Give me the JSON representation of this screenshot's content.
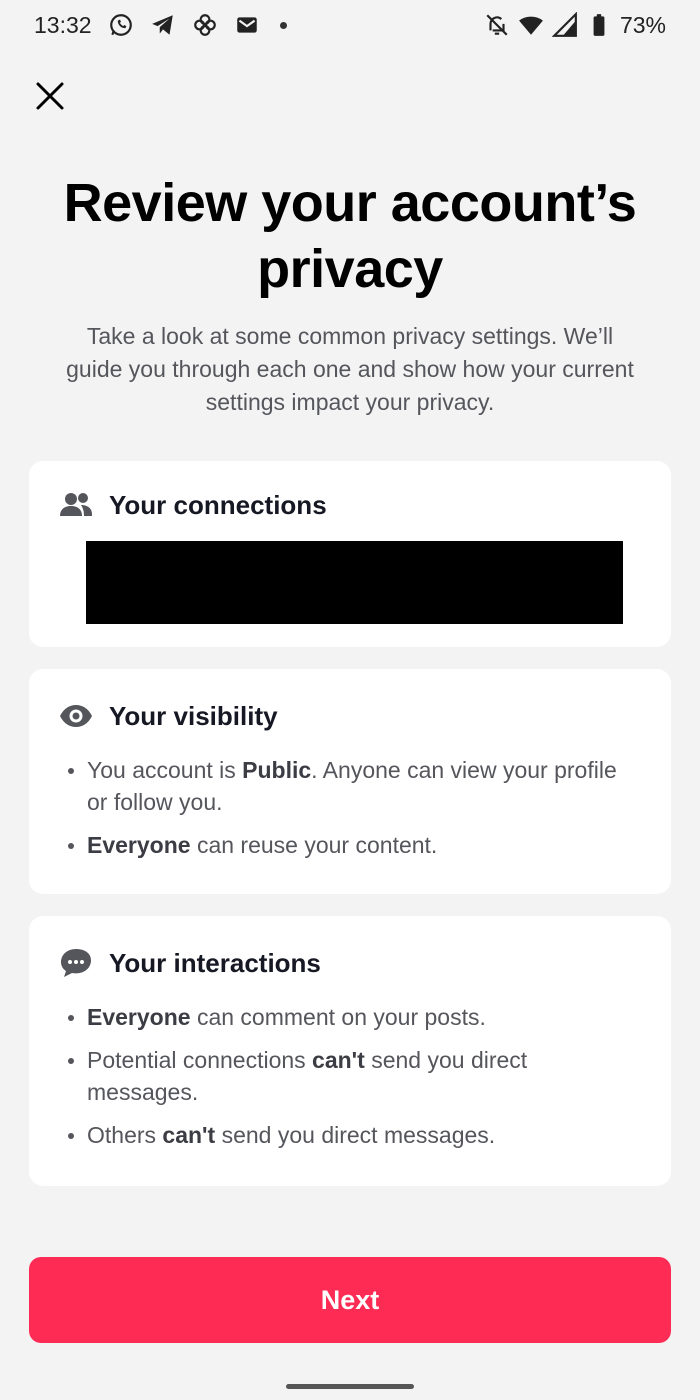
{
  "status_bar": {
    "time": "13:32",
    "left_icons": [
      "whatsapp-icon",
      "telegram-icon",
      "pinwheel-icon",
      "gmail-icon",
      "notification-dot"
    ],
    "right_icons": [
      "bell-off-icon",
      "wifi-icon",
      "signal-roaming-icon",
      "battery-icon"
    ],
    "battery_percent": "73%"
  },
  "header": {
    "close_icon": "close-icon",
    "title": "Review your account’s privacy",
    "subtitle": "Take a look at some common privacy settings. We’ll guide you through each one and show how your current settings impact your privacy."
  },
  "cards": {
    "connections": {
      "icon": "people-icon",
      "title": "Your connections"
    },
    "visibility": {
      "icon": "eye-icon",
      "title": "Your visibility",
      "bullets": [
        [
          {
            "t": "You account is "
          },
          {
            "t": "Public",
            "b": true
          },
          {
            "t": ". Anyone can view your profile or follow you."
          }
        ],
        [
          {
            "t": "Everyone",
            "b": true
          },
          {
            "t": " can reuse your content."
          }
        ]
      ]
    },
    "interactions": {
      "icon": "chat-bubble-icon",
      "title": "Your interactions",
      "bullets": [
        [
          {
            "t": "Everyone",
            "b": true
          },
          {
            "t": " can comment on your posts."
          }
        ],
        [
          {
            "t": "Potential connections "
          },
          {
            "t": "can't",
            "b": true
          },
          {
            "t": " send you direct messages."
          }
        ],
        [
          {
            "t": "Others "
          },
          {
            "t": "can't",
            "b": true
          },
          {
            "t": " send you direct messages."
          }
        ]
      ]
    }
  },
  "footer": {
    "next_label": "Next"
  },
  "colors": {
    "accent": "#fe2c55",
    "background": "#f3f3f3",
    "card": "#ffffff"
  }
}
